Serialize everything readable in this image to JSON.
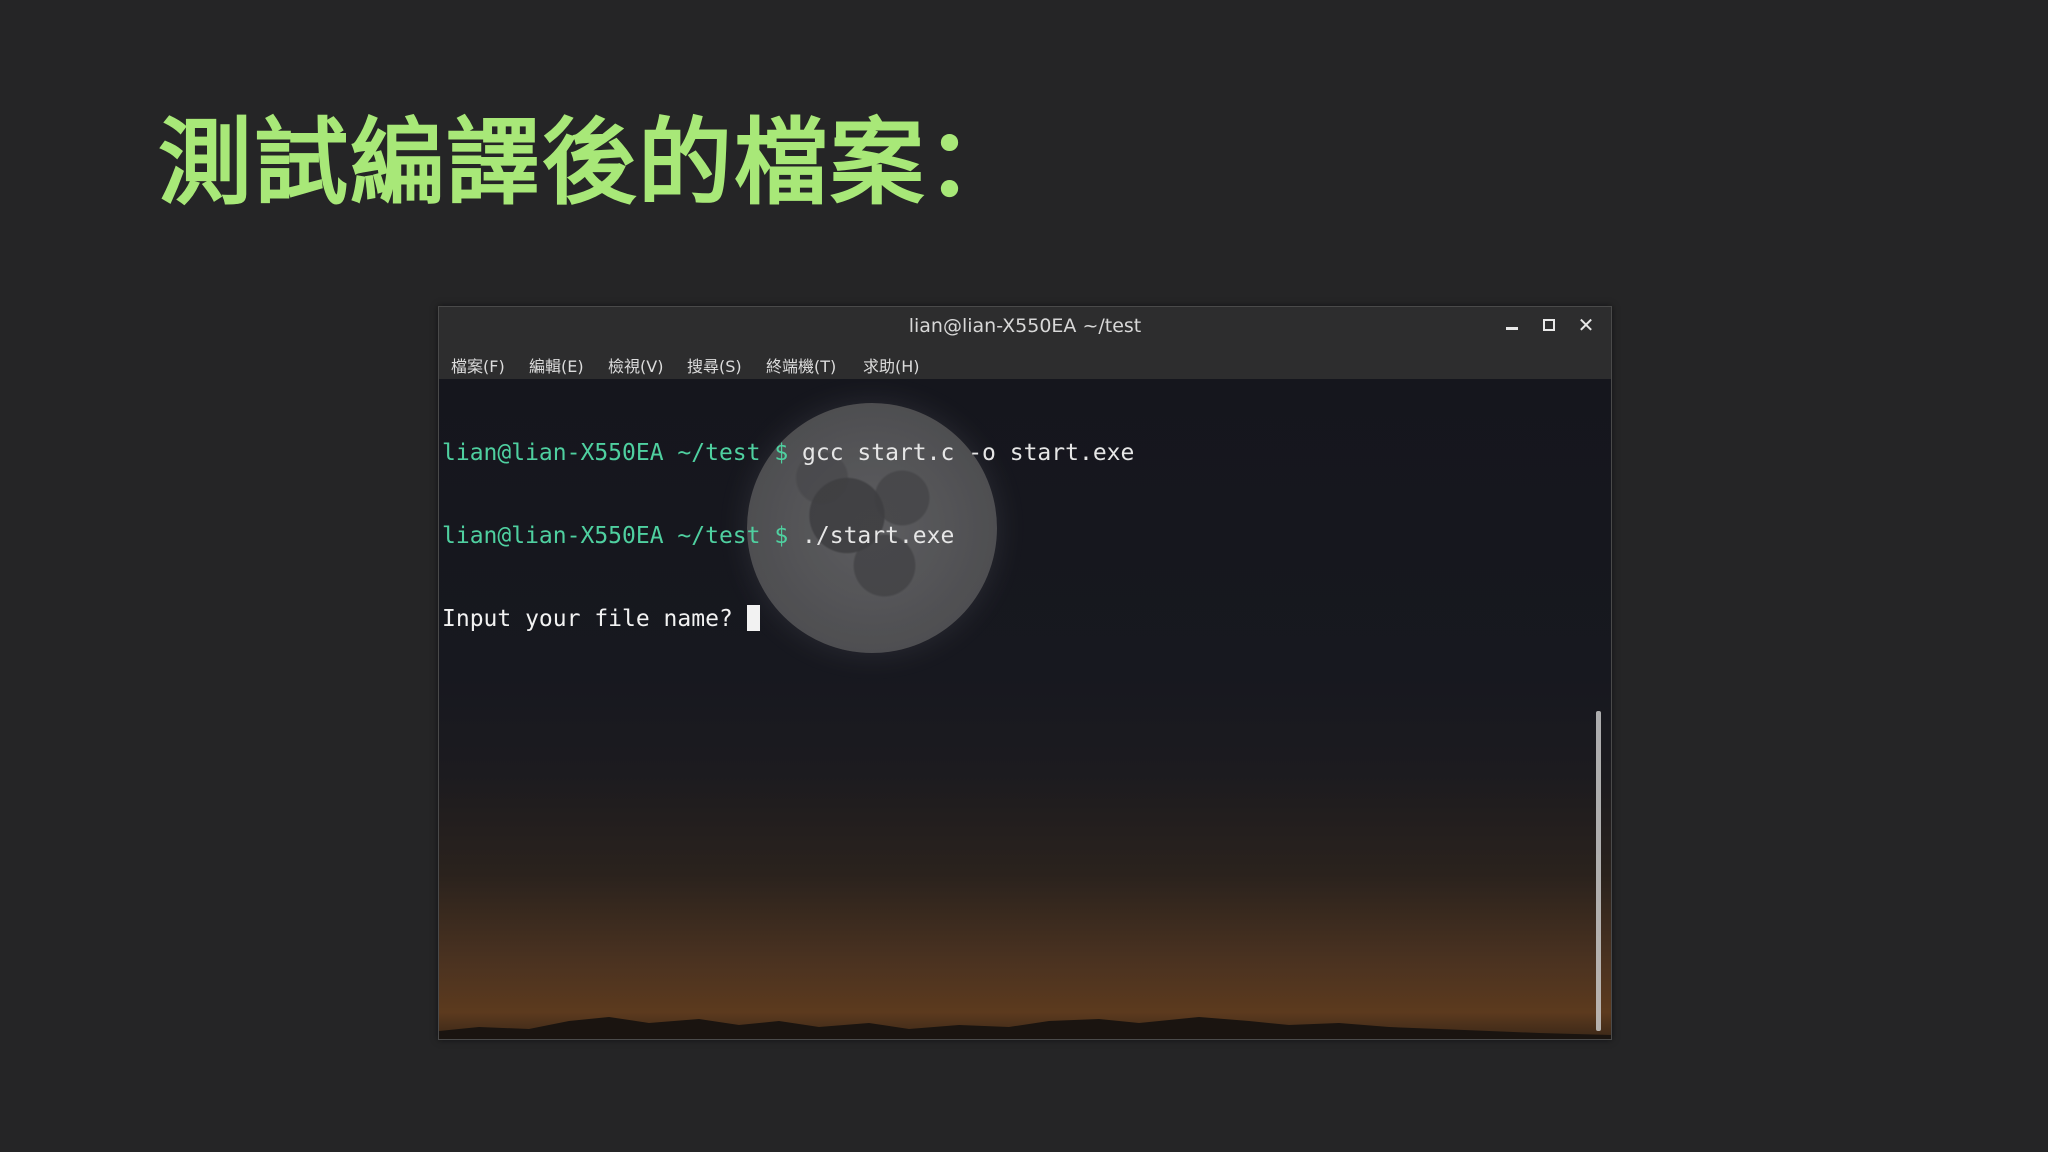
{
  "slide": {
    "title": "測試編譯後的檔案："
  },
  "window": {
    "title": "lian@lian-X550EA ~/test",
    "controls": {
      "minimize": "minimize",
      "maximize": "maximize",
      "close": "close"
    }
  },
  "menu": {
    "items": [
      {
        "label": "檔案(F)"
      },
      {
        "label": "編輯(E)"
      },
      {
        "label": "檢視(V)"
      },
      {
        "label": "搜尋(S)"
      },
      {
        "label": "終端機(T)"
      },
      {
        "label": "求助(H)"
      }
    ]
  },
  "terminal": {
    "lines": [
      {
        "prompt": "lian@lian-X550EA ~/test $",
        "command": " gcc start.c -o start.exe"
      },
      {
        "prompt": "lian@lian-X550EA ~/test $",
        "command": " ./start.exe"
      }
    ],
    "output": "Input your file name? "
  },
  "colors": {
    "title": "#a8e878",
    "prompt": "#4fd0a0",
    "background": "#252526"
  }
}
